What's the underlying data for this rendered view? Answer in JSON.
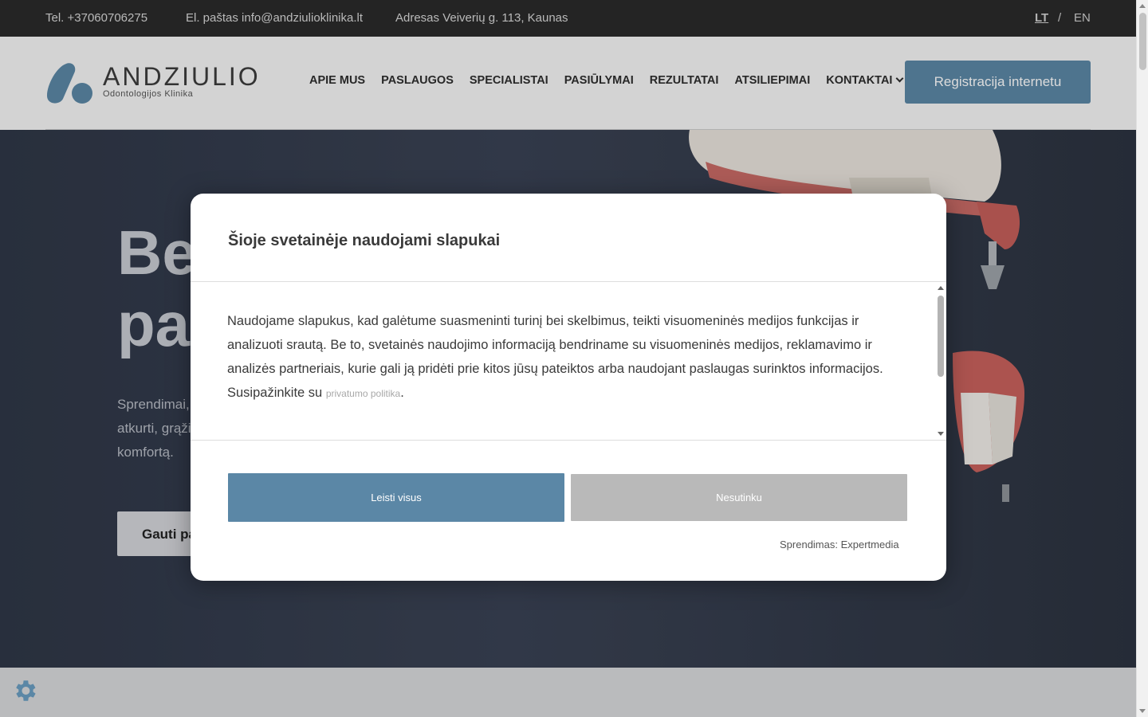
{
  "topbar": {
    "phone": "Tel. +37060706275",
    "email": "El. paštas info@andziulioklinika.lt",
    "address": "Adresas Veiverių g. 113, Kaunas",
    "lang_lt": "LT",
    "lang_sep": "/",
    "lang_en": "EN"
  },
  "header": {
    "logo_name": "ANDZIULIO",
    "logo_sub": "Odontologijos Klinika",
    "nav": [
      "APIE MUS",
      "PASLAUGOS",
      "SPECIALISTAI",
      "PASIŪLYMAI",
      "REZULTATAI",
      "ATSILIEPIMAI",
      "KONTAKTAI"
    ],
    "cta": "Registracija internetu"
  },
  "hero": {
    "title_line1": "Be",
    "title_line2": "pa",
    "text_line1": "Sprendimai,",
    "text_line2": "atkurti, grąžin",
    "text_line3": "komfortą.",
    "button": "Gauti pa"
  },
  "cookie_modal": {
    "title": "Šioje svetainėje naudojami slapukai",
    "body": "Naudojame slapukus, kad galėtume suasmeninti turinį bei skelbimus, teikti visuomeninės medijos funkcijas ir analizuoti srautą. Be to, svetainės naudojimo informaciją bendriname su visuomeninės medijos, reklamavimo ir analizės partneriais, kurie gali ją pridėti prie kitos jūsų pateiktos arba naudojant paslaugas surinktos informacijos. Susipažinkite su",
    "link": "privatumo politika",
    "body_end": ".",
    "allow_button": "Leisti visus",
    "deny_button": "Nesutinku",
    "credit": "Sprendimas: Expertmedia"
  },
  "colors": {
    "accent": "#5b87a6",
    "topbar_bg": "#2b2b2b",
    "hero_bg": "#343c4c"
  },
  "icons": [
    "settings-gear-icon",
    "chevron-down-icon",
    "logo-icon"
  ]
}
